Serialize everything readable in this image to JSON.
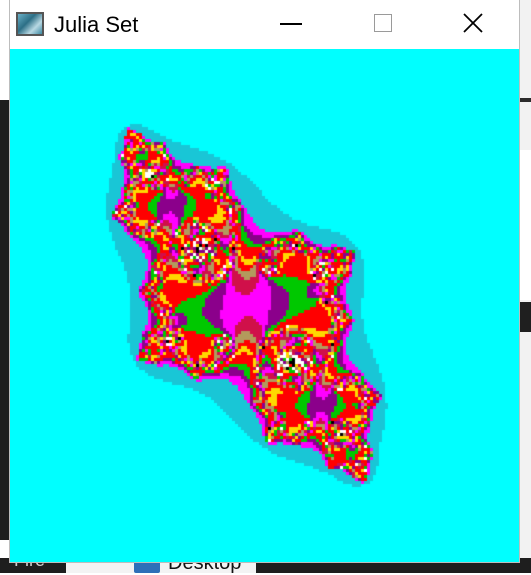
{
  "window": {
    "title": "Julia Set",
    "icon": "julia-app-icon",
    "controls": [
      "minimize-icon",
      "maximize-icon",
      "close-icon"
    ]
  },
  "canvas": {
    "background": "#00ffff",
    "palette": [
      "#ff0000",
      "#ffd800",
      "#b39a5c",
      "#8b008b",
      "#ff00ff",
      "#00c800",
      "#000000",
      "#ffffff",
      "#19c6d6",
      "#d0104a"
    ]
  },
  "desktop": {
    "taskbar_label": "Desktop",
    "left_text": "Fire"
  }
}
